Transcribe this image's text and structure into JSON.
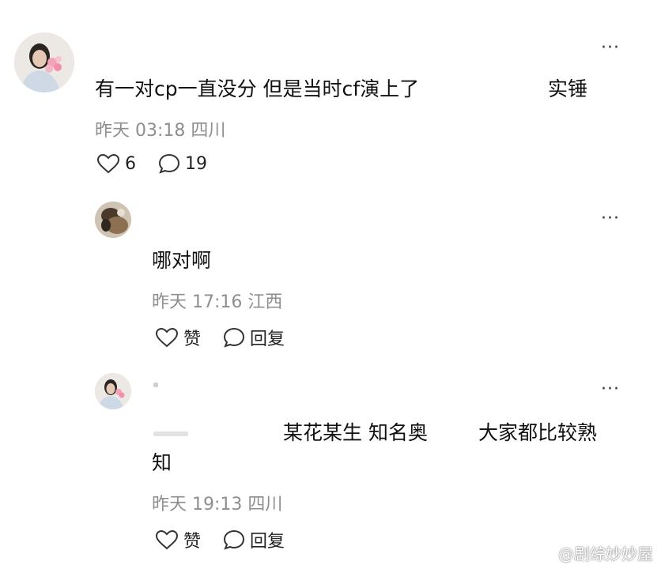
{
  "comment_main": {
    "text_part1": "有一对cp一直没分 但是当时cf演上了",
    "text_part2": "实锤",
    "time": "昨天 03:18",
    "location": "四川",
    "likes": "6",
    "replies": "19"
  },
  "reply1": {
    "text": "哪对啊",
    "time": "昨天 17:16",
    "location": "江西",
    "like_label": "赞",
    "reply_label": "回复"
  },
  "reply2": {
    "text_part1": "某花某生 知名奥",
    "text_part2": "大家都比较熟",
    "text_part3": "知",
    "time": "昨天 19:13",
    "location": "四川",
    "like_label": "赞",
    "reply_label": "回复"
  },
  "more_glyph": "···",
  "watermark": "@剧综妙妙屋",
  "icons": {
    "heart": "heart-icon",
    "comment": "comment-bubble-icon",
    "more": "more-dots-icon"
  },
  "colors": {
    "text": "#111111",
    "meta": "#8e8e8e",
    "icon": "#333333"
  }
}
